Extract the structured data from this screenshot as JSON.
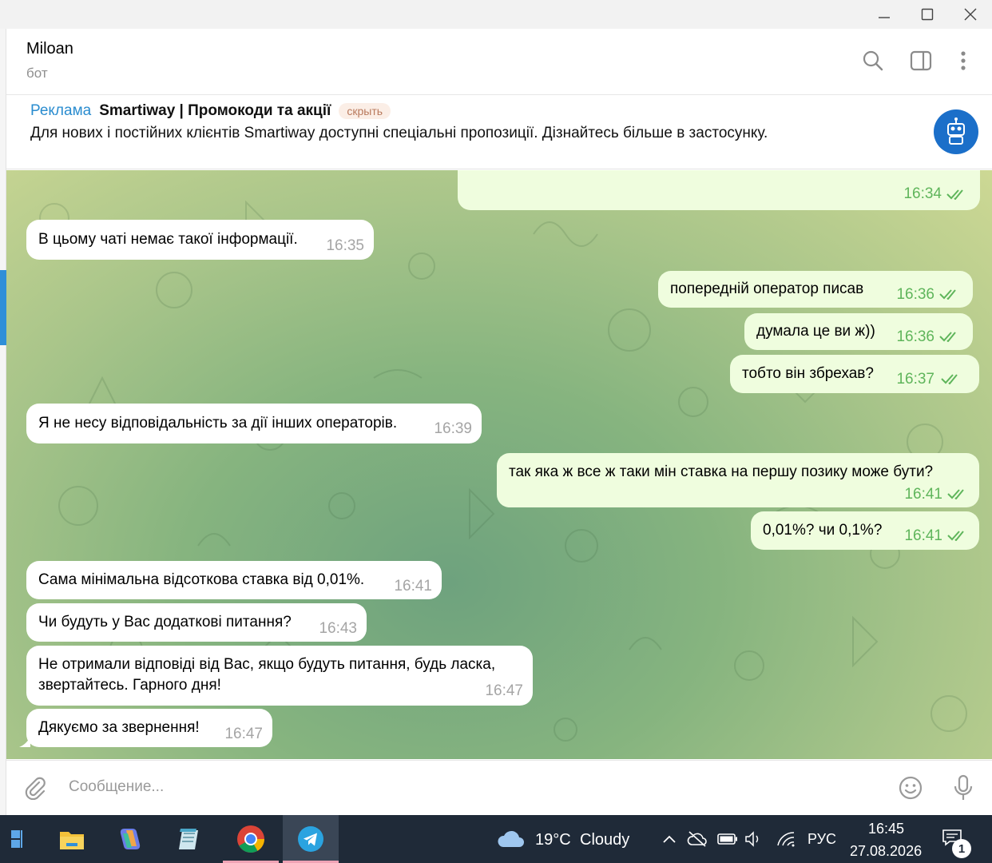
{
  "chat": {
    "title": "Miloan",
    "subtitle": "бот"
  },
  "ad": {
    "label": "Реклама",
    "title": "Smartiway | Промокоди та акції",
    "hide_label": "скрыть",
    "text": "Для нових і постійних клієнтів Smartiway доступні спеціальні пропозиції. Дізнайтесь більше в застосунку."
  },
  "messages": [
    {
      "dir": "out",
      "text": "",
      "time": "16:34",
      "read": true
    },
    {
      "dir": "in",
      "text": "В цьому чаті немає такої інформації.",
      "time": "16:35"
    },
    {
      "dir": "out",
      "text": "попередній оператор писав",
      "time": "16:36",
      "read": true
    },
    {
      "dir": "out",
      "text": "думала це ви ж))",
      "time": "16:36",
      "read": true
    },
    {
      "dir": "out",
      "text": "тобто він збрехав?",
      "time": "16:37",
      "read": true
    },
    {
      "dir": "in",
      "text": "Я не несу відповідальність за дії інших операторів.",
      "time": "16:39"
    },
    {
      "dir": "out",
      "text": "так яка ж все ж таки мін ставка на першу позику може бути?",
      "time": "16:41",
      "read": true
    },
    {
      "dir": "out",
      "text": "0,01%? чи 0,1%?",
      "time": "16:41",
      "read": true
    },
    {
      "dir": "in",
      "text": "Сама мінімальна відсоткова ставка від 0,01%.",
      "time": "16:41"
    },
    {
      "dir": "in",
      "text": "Чи будуть у Вас додаткові питання?",
      "time": "16:43"
    },
    {
      "dir": "in",
      "text_line1": "Не отримали відповіді від Вас, якщо будуть питання, будь ласка,",
      "text_line2": "звертайтесь. Гарного дня!",
      "time": "16:47"
    },
    {
      "dir": "in",
      "text": "Дякуємо за звернення!",
      "time": "16:47"
    }
  ],
  "composer": {
    "placeholder": "Сообщение..."
  },
  "icons": {
    "header": [
      "search-icon",
      "sidebar-toggle-icon",
      "more-vertical-icon"
    ],
    "composer": [
      "paperclip-icon",
      "emoji-icon",
      "microphone-icon"
    ],
    "window": [
      "minimize-icon",
      "maximize-icon",
      "close-icon"
    ]
  },
  "taskbar": {
    "apps": [
      "start-icon",
      "file-explorer-icon",
      "copilot-icon",
      "notepad-icon",
      "chrome-icon",
      "telegram-icon"
    ],
    "weather_temp": "19°C",
    "weather_desc": "Cloudy",
    "language": "РУС",
    "time": "16:45",
    "date": "27.08.2026",
    "notification_count": "1"
  },
  "colors": {
    "accent": "#2a8ccf",
    "outgoing_bubble": "#effdde",
    "incoming_bubble": "#ffffff",
    "read_tick": "#5fb55b",
    "taskbar": "#1f2a38"
  }
}
